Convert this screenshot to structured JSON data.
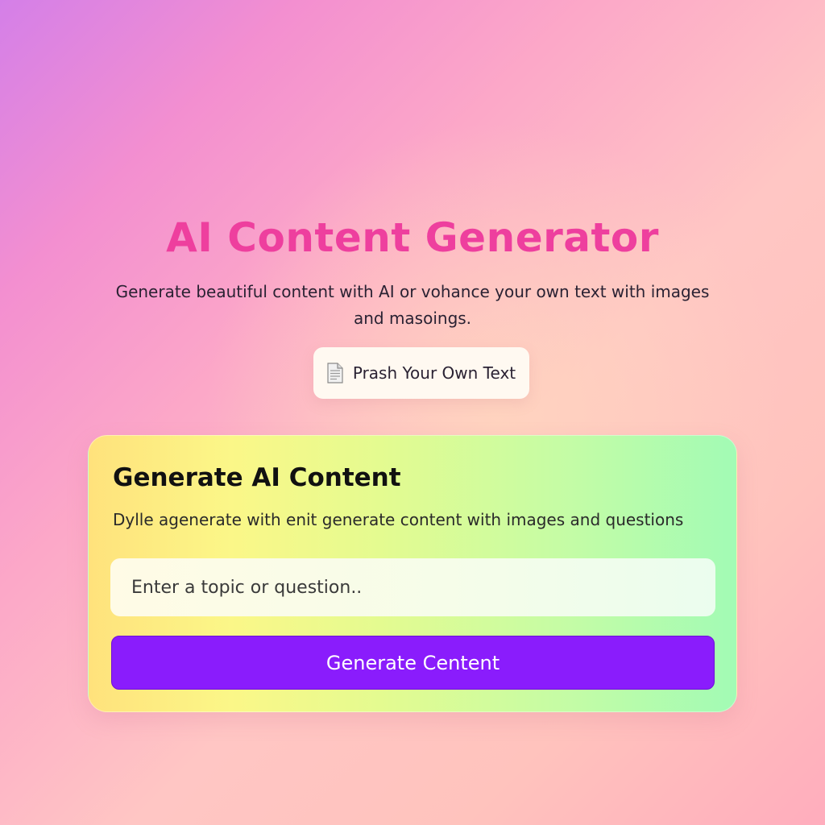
{
  "header": {
    "title": "AI Content Generator",
    "subtitle": "Generate beautiful content with AI or vohance your own text with images and masoings."
  },
  "own_text_button": {
    "label": "Prash Your Own Text",
    "icon": "document-icon"
  },
  "generate_card": {
    "title": "Generate AI Content",
    "description": "Dylle agenerate with enit generate content with images and questions",
    "input": {
      "value": "",
      "placeholder": "Enter a topic or question.."
    },
    "button_label": "Generate Centent"
  },
  "colors": {
    "title": "#ee3f9e",
    "button": "#8a1cfc",
    "card_start": "#ffe27c",
    "card_end": "#a2fbb5"
  }
}
